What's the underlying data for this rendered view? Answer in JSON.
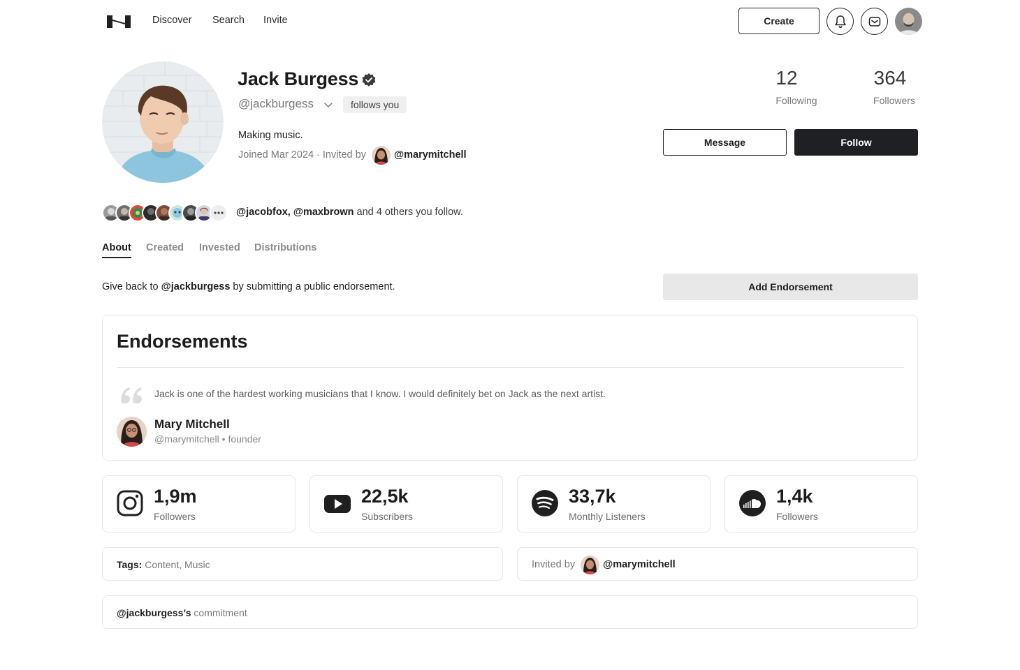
{
  "nav": {
    "logo": "logo-icon",
    "links": [
      "Discover",
      "Search",
      "Invite"
    ],
    "create_label": "Create",
    "icons": [
      "bell-icon",
      "mail-icon"
    ]
  },
  "profile": {
    "name": "Jack Burgess",
    "verified": true,
    "handle": "@jackburgess",
    "follows_badge": "follows you",
    "bio": "Making music.",
    "joined": "Joined Mar 2024 · Invited by",
    "invited_by": "@marymitchell",
    "following_count": "12",
    "following_label": "Following",
    "followers_count": "364",
    "followers_label": "Followers",
    "message_label": "Message",
    "follow_label": "Follow"
  },
  "mutuals": {
    "names": "@jacobfox, @maxbrown",
    "rest": " and 4 others you follow."
  },
  "tabs": [
    {
      "label": "About",
      "active": true
    },
    {
      "label": "Created",
      "active": false
    },
    {
      "label": "Invested",
      "active": false
    },
    {
      "label": "Distributions",
      "active": false
    }
  ],
  "giveback": {
    "prefix": "Give back to ",
    "handle": "@jackburgess",
    "suffix": " by submitting a public endorsement.",
    "button_label": "Add Endorsement"
  },
  "endorsements": {
    "title": "Endorsements",
    "items": [
      {
        "quote": "Jack is one of the hardest working musicians that I know. I would definitely bet on Jack as the next artist.",
        "author": "Mary Mitchell",
        "handle": "@marymitchell",
        "role": "founder"
      }
    ]
  },
  "socials": [
    {
      "platform": "instagram-icon",
      "value": "1,9m",
      "label": "Followers"
    },
    {
      "platform": "youtube-icon",
      "value": "22,5k",
      "label": "Subscribers"
    },
    {
      "platform": "spotify-icon",
      "value": "33,7k",
      "label": "Monthly Listeners"
    },
    {
      "platform": "soundcloud-icon",
      "value": "1,4k",
      "label": "Followers"
    }
  ],
  "tags": {
    "label": "Tags:",
    "values": "Content, Music"
  },
  "invited_card": {
    "label": "Invited by",
    "handle": "@marymitchell"
  },
  "commitment": {
    "handle": "@jackburgess’s",
    "label": " commitment"
  },
  "colors": {
    "primary_dark": "#1f2024",
    "muted_text": "#7a7a7a",
    "border": "#e6e6e6",
    "badge_bg": "#efefef"
  }
}
